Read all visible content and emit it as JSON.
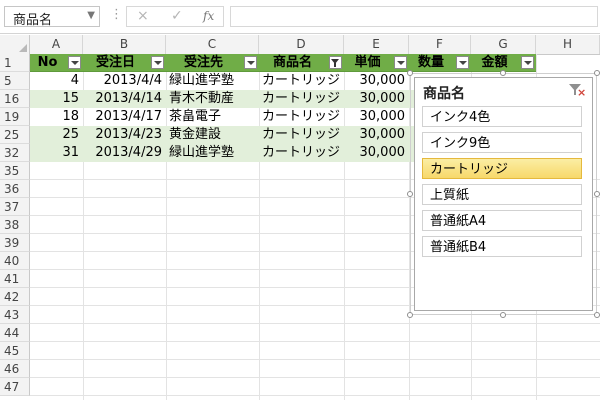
{
  "formula_bar": {
    "name_box": "商品名",
    "cancel_icon": "×",
    "enter_icon": "✓",
    "fx_label": "fx",
    "formula": ""
  },
  "columns": [
    "A",
    "B",
    "C",
    "D",
    "E",
    "F",
    "G",
    "H"
  ],
  "rows": [
    "1",
    "5",
    "16",
    "19",
    "25",
    "32",
    "35",
    "36",
    "37",
    "38",
    "39",
    "40",
    "41",
    "42",
    "43",
    "44",
    "45",
    "46",
    "47",
    "48"
  ],
  "table": {
    "headers": [
      "No",
      "受注日",
      "受注先",
      "商品名",
      "単価",
      "数量",
      "金額"
    ],
    "filter_active_column": "商品名",
    "data": [
      {
        "no": "4",
        "date": "2013/4/4",
        "client": "緑山進学塾",
        "product": "カートリッジ",
        "price": "30,000"
      },
      {
        "no": "15",
        "date": "2013/4/14",
        "client": "青木不動産",
        "product": "カートリッジ",
        "price": "30,000"
      },
      {
        "no": "18",
        "date": "2013/4/17",
        "client": "茶畠電子",
        "product": "カートリッジ",
        "price": "30,000"
      },
      {
        "no": "25",
        "date": "2013/4/23",
        "client": "黄金建設",
        "product": "カートリッジ",
        "price": "30,000"
      },
      {
        "no": "31",
        "date": "2013/4/29",
        "client": "緑山進学塾",
        "product": "カートリッジ",
        "price": "30,000"
      }
    ]
  },
  "slicer": {
    "title": "商品名",
    "items": [
      "インク4色",
      "インク9色",
      "カートリッジ",
      "上質紙",
      "普通紙A4",
      "普通紙B4"
    ],
    "selected": "カートリッジ"
  },
  "colors": {
    "header_green": "#70ad47",
    "band_green": "#e2efda",
    "selected_item": "#f7d86a"
  }
}
